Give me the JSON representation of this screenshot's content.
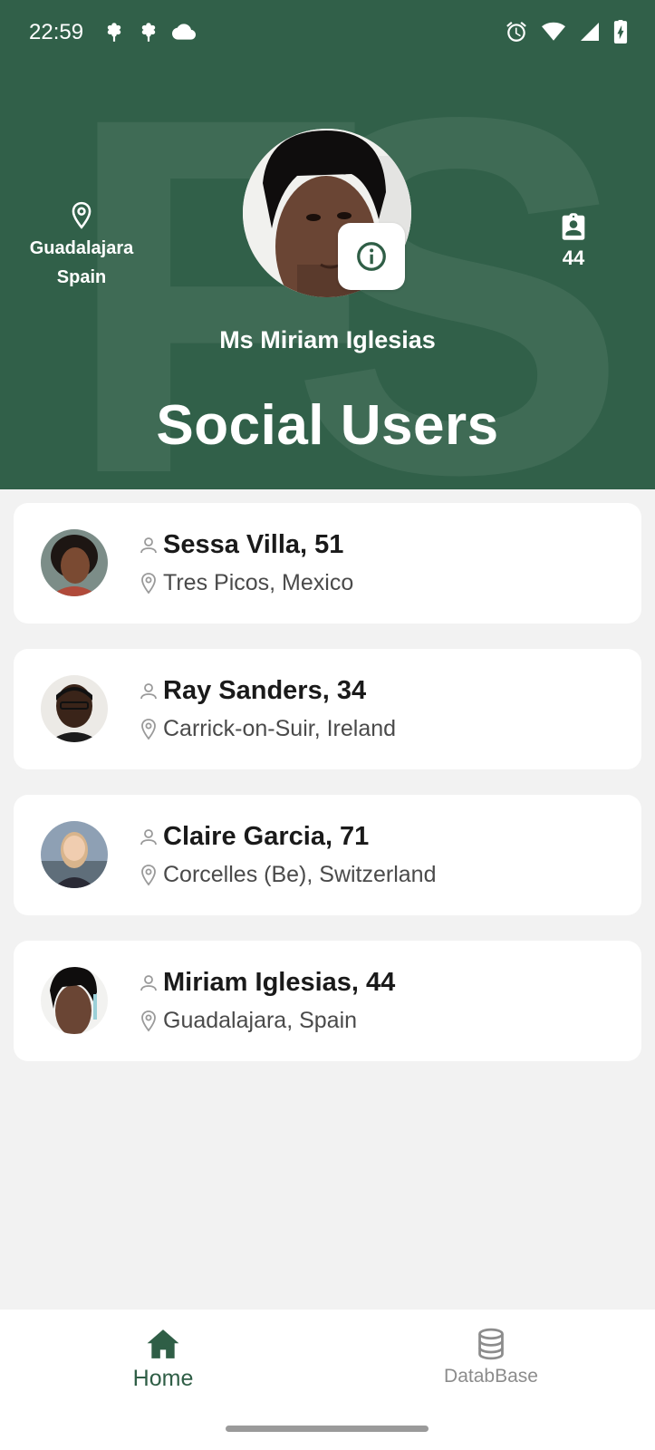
{
  "status_bar": {
    "time": "22:59",
    "left_icons": [
      "flower-icon",
      "flower-icon",
      "cloud-icon"
    ],
    "right_icons": [
      "alarm-icon",
      "wifi-icon",
      "signal-icon",
      "battery-charging-icon"
    ]
  },
  "header": {
    "watermark_letters": "FS",
    "location_icon": "location-pin-icon",
    "location_city": "Guadalajara",
    "location_country": "Spain",
    "posts_icon": "assignment-ind-icon",
    "posts_count": "44",
    "info_icon": "info-icon",
    "profile_name": "Ms Miriam Iglesias",
    "app_title": "Social Users",
    "background_color": "#316049"
  },
  "users": [
    {
      "name_age": "Sessa Villa, 51",
      "location": "Tres Picos, Mexico"
    },
    {
      "name_age": "Ray Sanders, 34",
      "location": "Carrick-on-Suir, Ireland"
    },
    {
      "name_age": "Claire Garcia, 71",
      "location": "Corcelles (Be), Switzerland"
    },
    {
      "name_age": "Miriam Iglesias, 44",
      "location": "Guadalajara, Spain"
    }
  ],
  "bottom_nav": {
    "home_icon": "home-icon",
    "home_label": "Home",
    "db_icon": "database-icon",
    "db_label": "DatabBase",
    "active_color": "#2f5e46",
    "inactive_color": "#8c8c8c"
  }
}
